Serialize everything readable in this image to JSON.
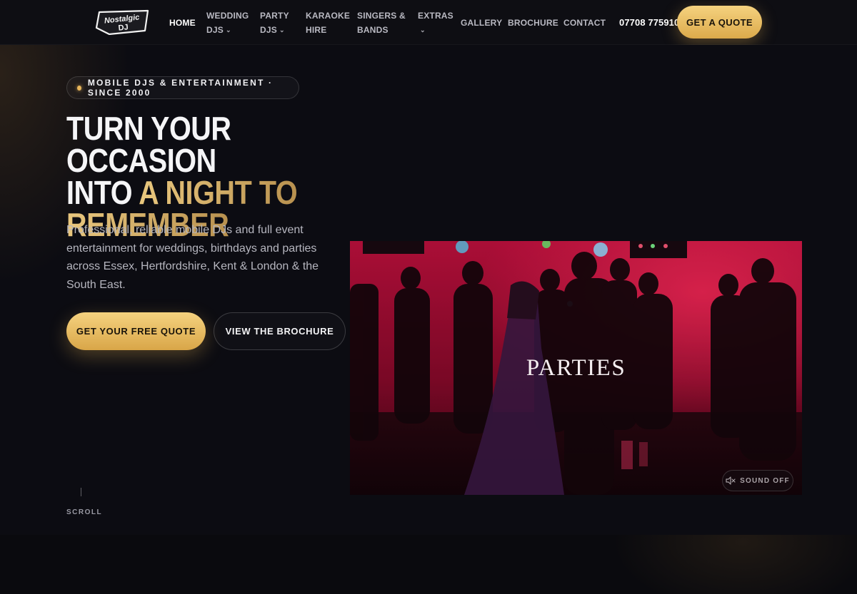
{
  "header": {
    "logo_text_line1": "Nostalgic",
    "logo_text_line2": "DJ",
    "nav": [
      {
        "label_line1": "HOME",
        "label_line2": "",
        "has_dropdown": false,
        "active": true
      },
      {
        "label_line1": "WEDDING",
        "label_line2": "DJS",
        "has_dropdown": true,
        "active": false
      },
      {
        "label_line1": "PARTY",
        "label_line2": "DJS",
        "has_dropdown": true,
        "active": false
      },
      {
        "label_line1": "KARAOKE",
        "label_line2": "HIRE",
        "has_dropdown": false,
        "active": false
      },
      {
        "label_line1": "SINGERS &",
        "label_line2": "BANDS",
        "has_dropdown": false,
        "active": false
      },
      {
        "label_line1": "EXTRAS",
        "label_line2": "",
        "has_dropdown": true,
        "active": false
      },
      {
        "label_line1": "GALLERY",
        "label_line2": "",
        "has_dropdown": false,
        "active": false
      },
      {
        "label_line1": "BROCHURE",
        "label_line2": "",
        "has_dropdown": false,
        "active": false
      },
      {
        "label_line1": "CONTACT",
        "label_line2": "",
        "has_dropdown": false,
        "active": false
      }
    ],
    "phone": "07708 775910",
    "quote_button": "GET A QUOTE"
  },
  "hero": {
    "badge": "MOBILE DJS & ENTERTAINMENT · SINCE 2000",
    "headline_line1": "TURN YOUR OCCASION",
    "headline_line2_plain": "INTO ",
    "headline_line2_gold": "A NIGHT TO",
    "headline_line3_gold": "REMEMBER",
    "lede": "Professional, reliable mobile DJs and full event entertainment for weddings, birthdays and parties across Essex, Hertfordshire, Kent & London & the South East.",
    "primary_button": "GET YOUR FREE QUOTE",
    "secondary_button": "VIEW THE BROCHURE",
    "scroll_label": "SCROLL"
  },
  "video": {
    "caption": "PARTIES",
    "sound_label": "SOUND OFF"
  },
  "colors": {
    "accent_gold": "#e8b55a",
    "background": "#0c0c12",
    "video_red": "#e0104e"
  }
}
